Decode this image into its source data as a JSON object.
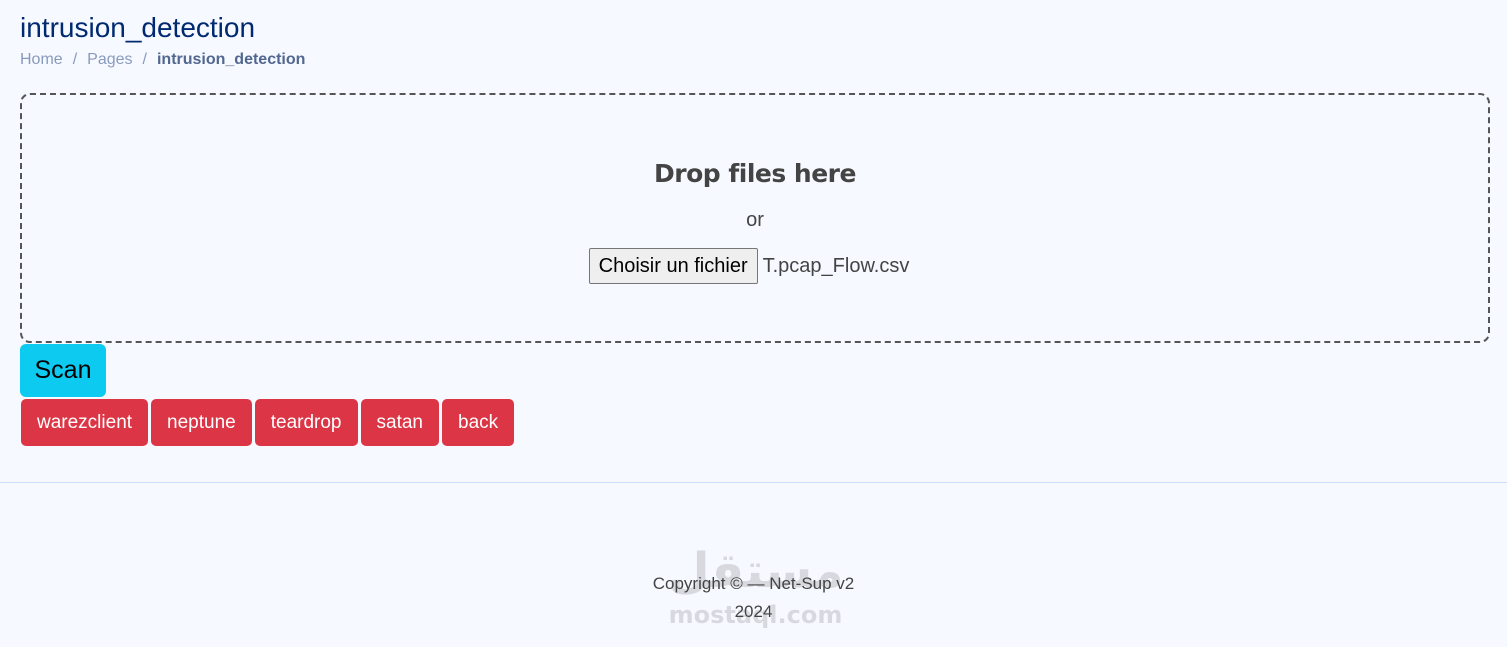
{
  "header": {
    "title": "intrusion_detection",
    "breadcrumb": {
      "home": "Home",
      "separator": "/",
      "pages": "Pages",
      "current": "intrusion_detection"
    }
  },
  "dropzone": {
    "title": "Drop files here",
    "or_text": "or",
    "file_button_label": "Choisir un fichier",
    "selected_file": "T.pcap_Flow.csv"
  },
  "scan_button": {
    "label": "Scan",
    "color": "#0dcaf0"
  },
  "attack_buttons": {
    "color": "#dc3545",
    "items": [
      {
        "label": "warezclient"
      },
      {
        "label": "neptune"
      },
      {
        "label": "teardrop"
      },
      {
        "label": "satan"
      },
      {
        "label": "back"
      }
    ]
  },
  "footer": {
    "copyright": "Copyright © — Net-Sup v2",
    "year": "2024"
  },
  "watermark": {
    "logo_text": "مستقل",
    "domain": "mostaql.com"
  }
}
